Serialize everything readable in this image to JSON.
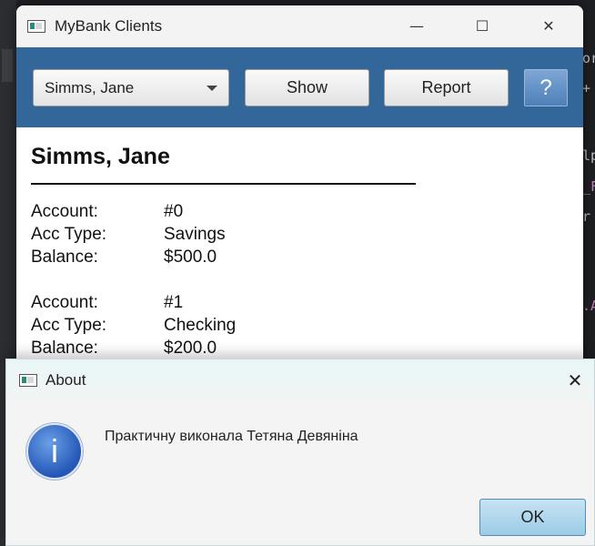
{
  "background": {
    "editor_glyphs": [
      "or",
      "+",
      "lp",
      "_F",
      "r",
      ".A"
    ]
  },
  "main_window": {
    "title": "MyBank Clients",
    "controls": {
      "minimize": "—",
      "maximize": "☐",
      "close": "✕"
    },
    "toolbar": {
      "client_select": "Simms, Jane",
      "show_label": "Show",
      "report_label": "Report",
      "help_label": "?"
    },
    "client": {
      "name": "Simms, Jane",
      "accounts": [
        {
          "account_label": "Account:",
          "account": "#0",
          "type_label": "Acc Type:",
          "type": "Savings",
          "balance_label": "Balance:",
          "balance": "$500.0"
        },
        {
          "account_label": "Account:",
          "account": "#1",
          "type_label": "Acc Type:",
          "type": "Checking",
          "balance_label": "Balance:",
          "balance": "$200.0"
        }
      ]
    }
  },
  "about_dialog": {
    "title": "About",
    "message": "Практичну виконала Тетяна Девяніна",
    "info_glyph": "i",
    "close_label": "✕",
    "ok_label": "OK"
  }
}
